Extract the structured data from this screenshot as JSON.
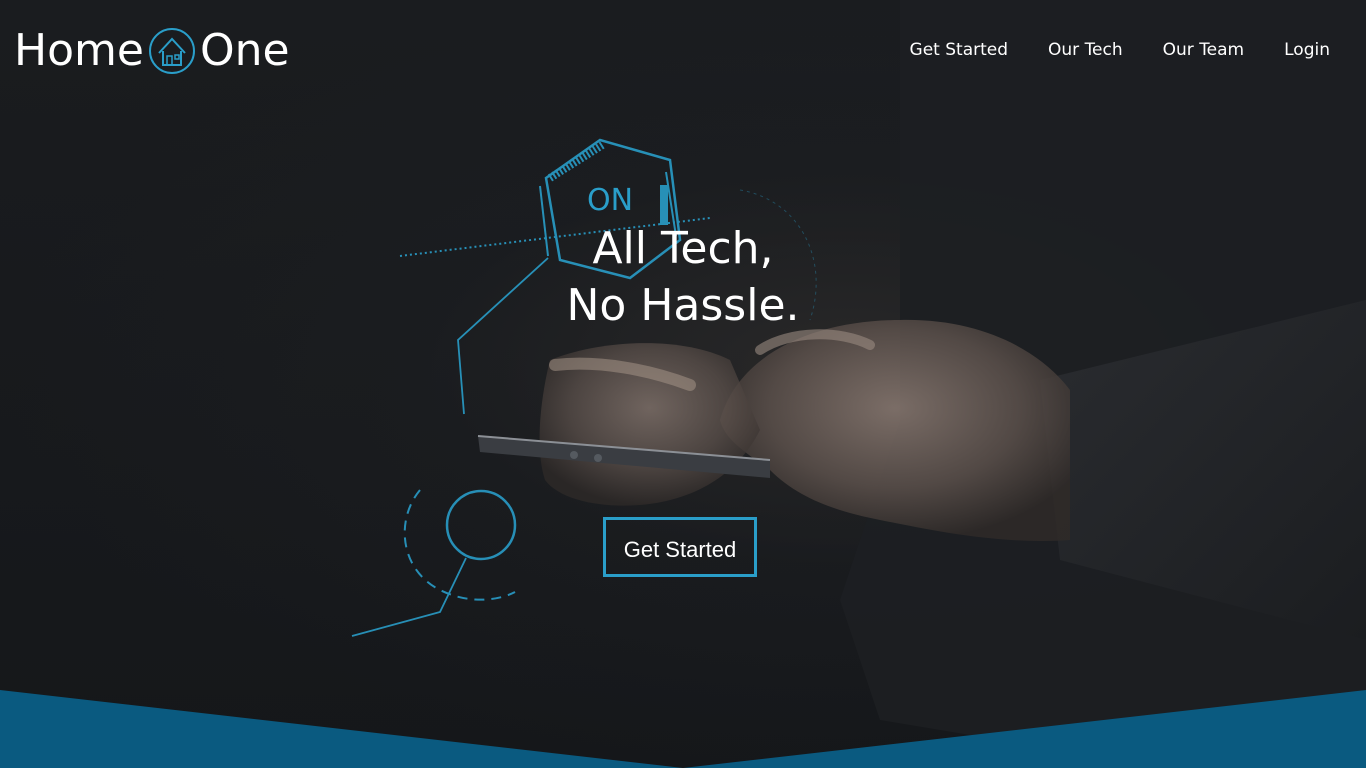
{
  "header": {
    "logo_left": "Home",
    "logo_right": "One",
    "nav": [
      {
        "label": "Get Started"
      },
      {
        "label": "Our Tech"
      },
      {
        "label": "Our Team"
      },
      {
        "label": "Login"
      }
    ]
  },
  "hero": {
    "badge_text": "ON",
    "headline_line1": "All Tech,",
    "headline_line2": "No Hassle.",
    "cta_label": "Get Started"
  },
  "colors": {
    "accent": "#2a9ec9",
    "band": "#0a5a80",
    "background": "#16181b",
    "text": "#ffffff"
  },
  "icons": [
    "house-logo-icon"
  ]
}
